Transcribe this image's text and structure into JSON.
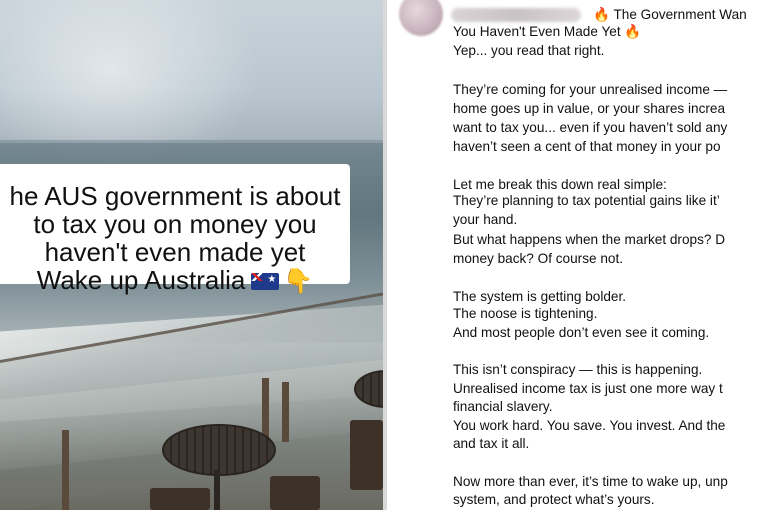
{
  "caption": {
    "line1": "he AUS government is about",
    "line2": "to tax you on money you",
    "line3": "haven't even made yet",
    "line4": "Wake up Australia",
    "flag_icon": "australia-flag-icon",
    "hand_icon": "backhand-index-pointing-down-icon"
  },
  "post": {
    "header_title_part": "The Government Wan",
    "header_title_line2": "You Haven't Even Made Yet",
    "fire_icon": "fire-icon",
    "lines": [
      "Yep... you read that right.",
      "They’re coming for your unrealised income —",
      "home goes up in value, or your shares increa",
      "want to tax you... even if you haven’t sold any",
      "haven’t seen a cent of that money in your po",
      "Let me break this down real simple:",
      "They’re planning to tax potential gains like it’",
      "your hand.",
      "But what happens when the market drops? D",
      "money back? Of course not.",
      "The system is getting bolder.",
      "The noose is tightening.",
      "And most people don’t even see it coming.",
      "This isn’t conspiracy — this is happening.",
      "Unrealised income tax is just one more way t",
      "financial slavery.",
      "You work hard. You save. You invest. And the",
      "and tax it all.",
      "Now more than ever, it’s time to wake up, unp",
      "system, and protect what’s yours."
    ]
  }
}
